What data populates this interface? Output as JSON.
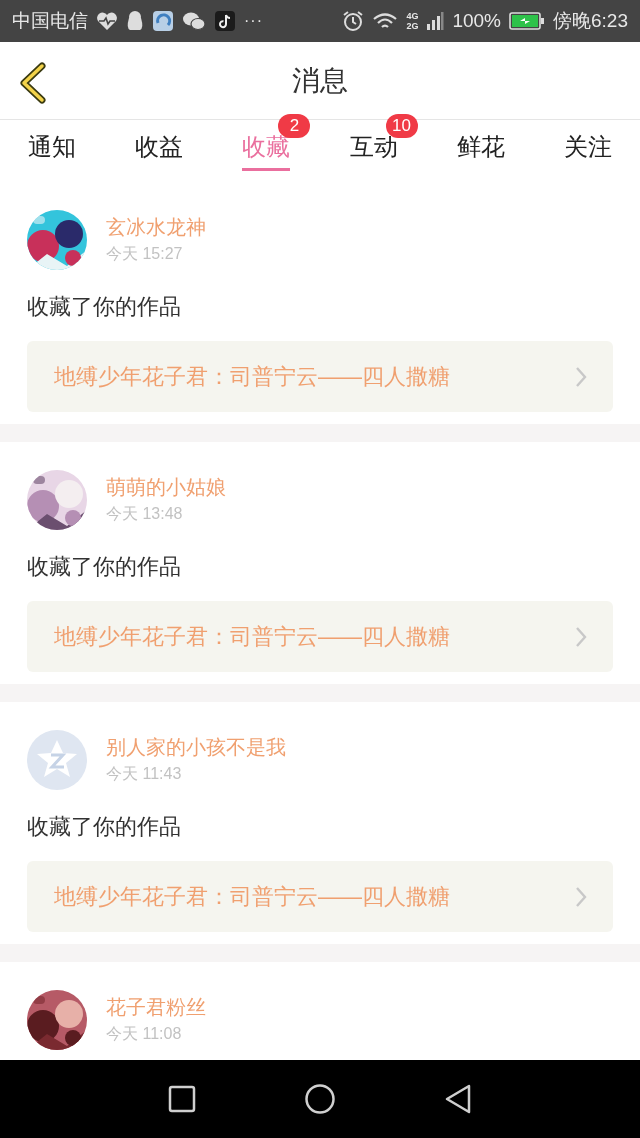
{
  "status_bar": {
    "carrier": "中国电信",
    "more": "···",
    "network_top": "4G",
    "network_bottom": "2G",
    "battery": "100%",
    "time": "傍晚6:23"
  },
  "header": {
    "title": "消息"
  },
  "tabs": [
    {
      "label": "通知",
      "selected": false
    },
    {
      "label": "收益",
      "selected": false
    },
    {
      "label": "收藏",
      "selected": true,
      "badge": "2"
    },
    {
      "label": "互动",
      "selected": false,
      "badge": "10"
    },
    {
      "label": "鲜花",
      "selected": false
    },
    {
      "label": "关注",
      "selected": false
    }
  ],
  "messages": [
    {
      "user": "玄冰水龙神",
      "time": "今天 15:27",
      "action": "收藏了你的作品",
      "work": "地缚少年花子君：司普宁云——四人撒糖"
    },
    {
      "user": "萌萌的小姑娘",
      "time": "今天 13:48",
      "action": "收藏了你的作品",
      "work": "地缚少年花子君：司普宁云——四人撒糖"
    },
    {
      "avatar": {
        "kind": "default"
      },
      "user": "别人家的小孩不是我",
      "time": "今天 11:43",
      "action": "收藏了你的作品",
      "work": "地缚少年花子君：司普宁云——四人撒糖"
    },
    {
      "user": "花子君粉丝",
      "time": "今天 11:08"
    }
  ]
}
